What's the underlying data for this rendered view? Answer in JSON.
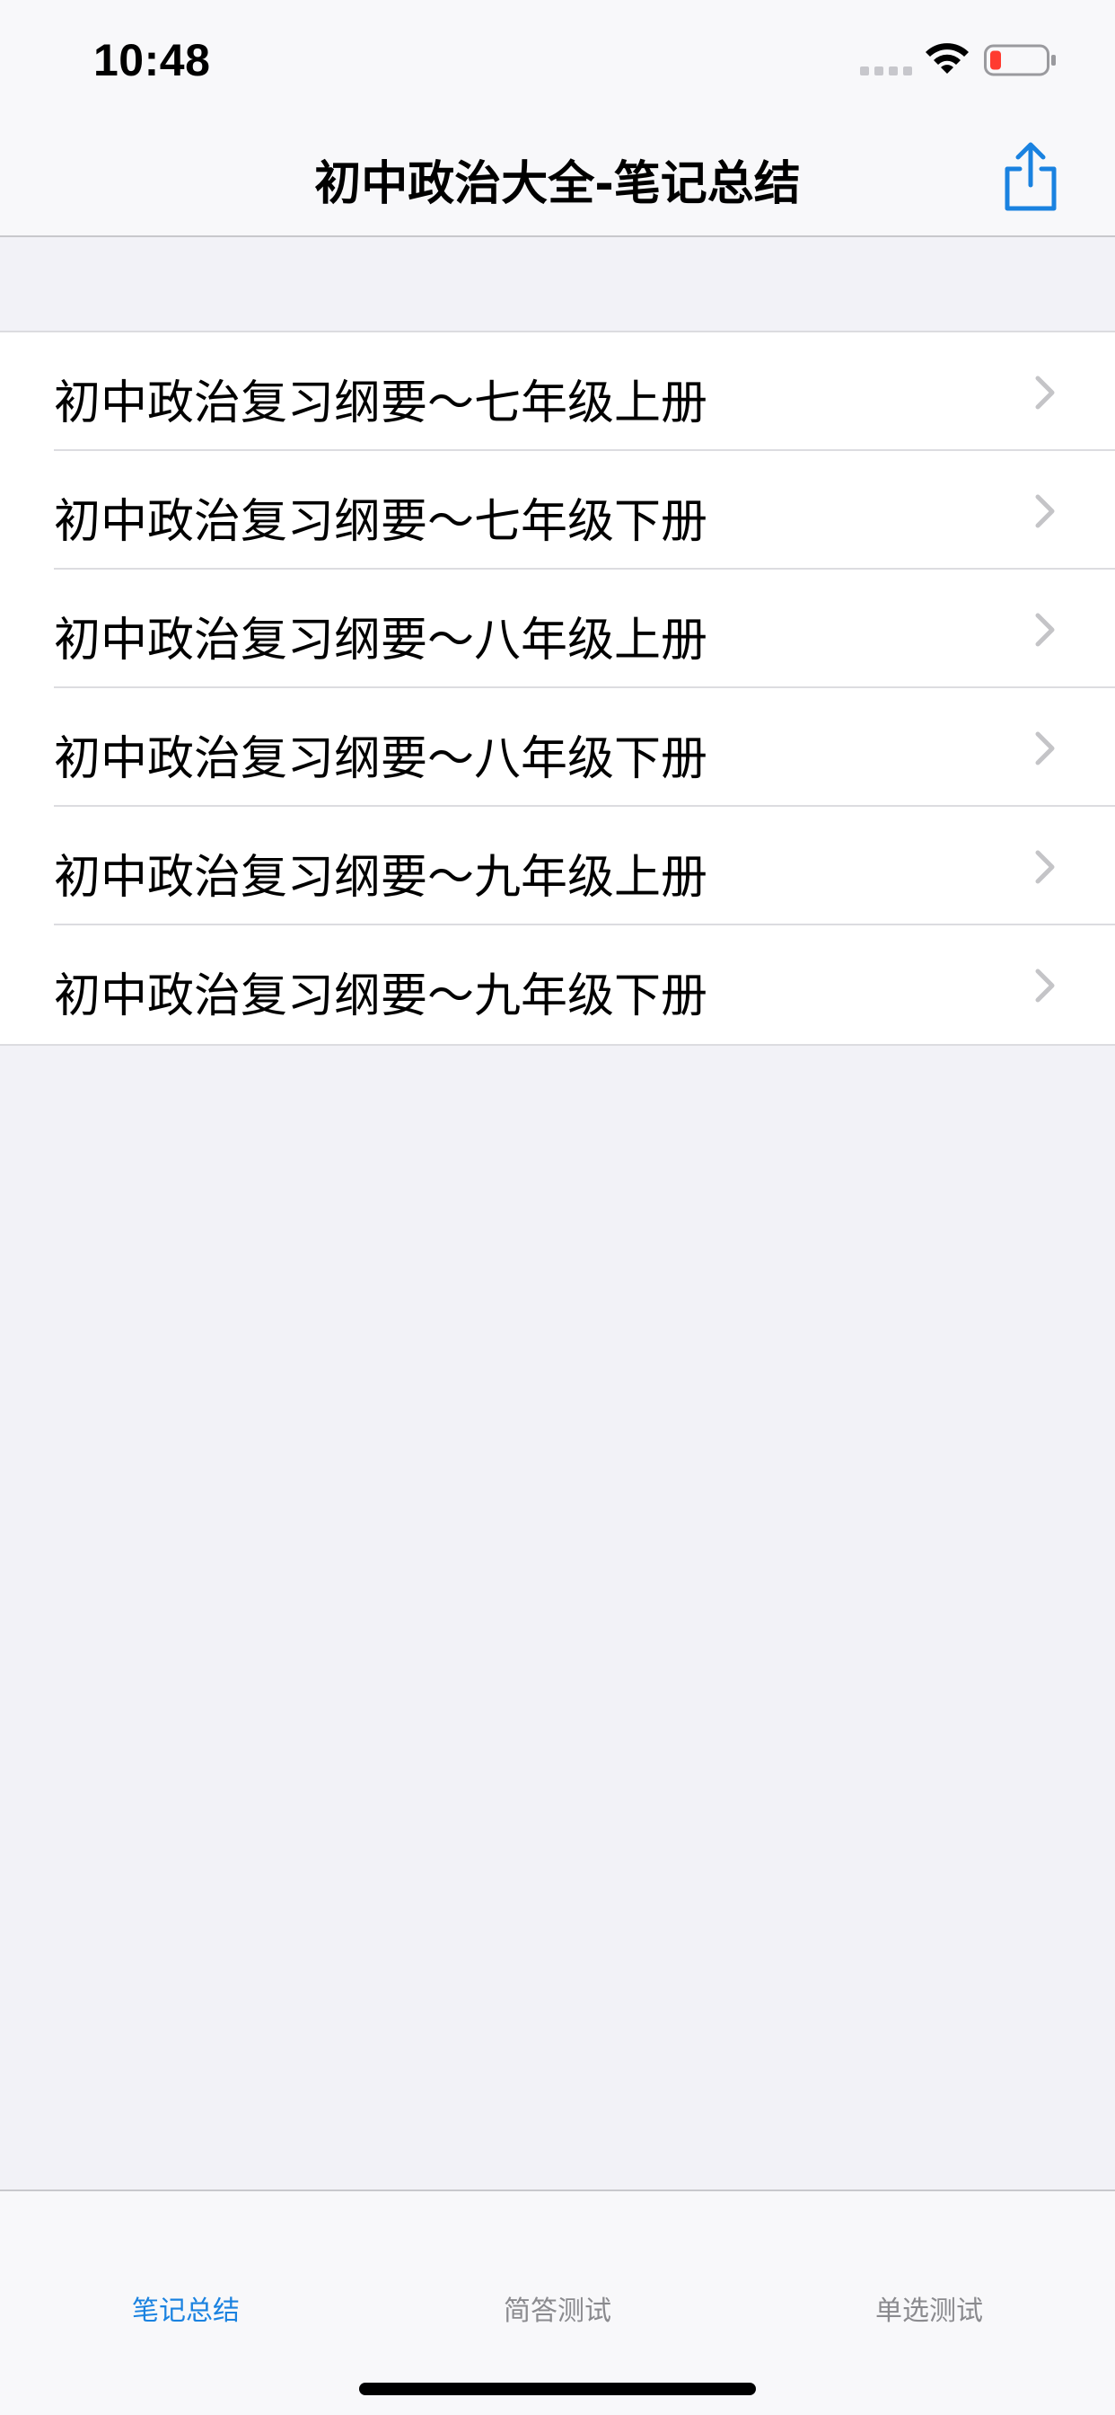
{
  "status_bar": {
    "time": "10:48",
    "battery_color": "#ff3b30"
  },
  "nav": {
    "title": "初中政治大全-笔记总结",
    "share_icon": "share-icon",
    "accent_color": "#1a82e0"
  },
  "list": {
    "items": [
      {
        "label": "初中政治复习纲要～七年级上册"
      },
      {
        "label": "初中政治复习纲要～七年级下册"
      },
      {
        "label": "初中政治复习纲要～八年级上册"
      },
      {
        "label": "初中政治复习纲要～八年级下册"
      },
      {
        "label": "初中政治复习纲要～九年级上册"
      },
      {
        "label": "初中政治复习纲要～九年级下册"
      }
    ]
  },
  "tab_bar": {
    "tabs": [
      {
        "label": "笔记总结",
        "active": true
      },
      {
        "label": "简答测试",
        "active": false
      },
      {
        "label": "单选测试",
        "active": false
      }
    ]
  }
}
